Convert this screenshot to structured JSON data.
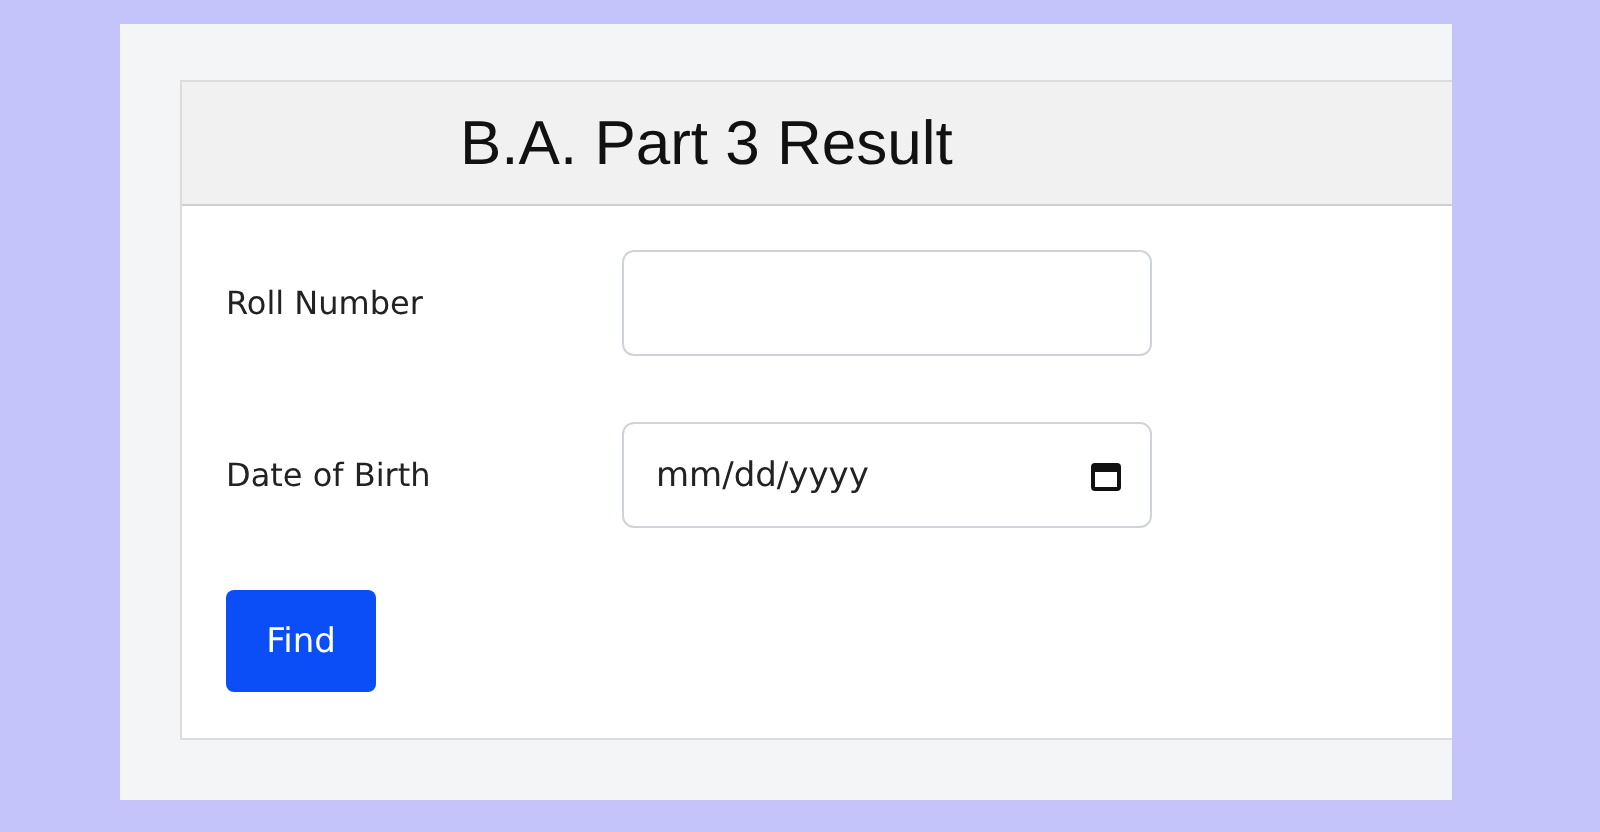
{
  "card": {
    "title": "B.A. Part 3 Result"
  },
  "fields": [
    {
      "kind": "text",
      "label": "Roll Number"
    },
    {
      "kind": "date",
      "label": "Date of Birth",
      "placeholder": "mm/dd/yyyy"
    }
  ],
  "button": {
    "label": "Find"
  }
}
